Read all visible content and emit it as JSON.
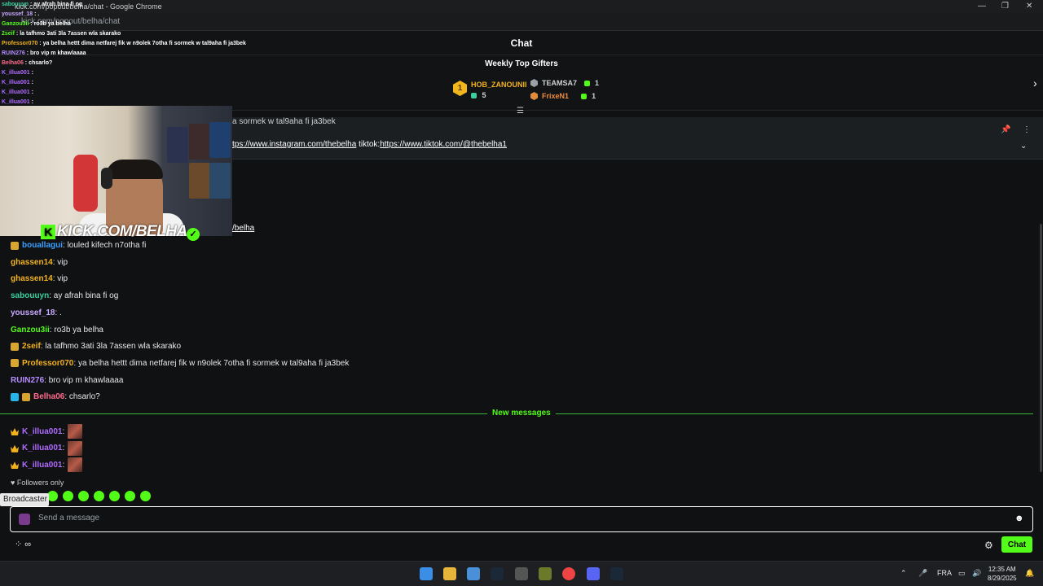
{
  "browser": {
    "window_title": "kick.com/popout/belha/chat - Google Chrome",
    "url": "kick.com/popout/belha/chat"
  },
  "header": {
    "title": "Chat"
  },
  "gifters": {
    "title": "Weekly Top Gifters",
    "first": {
      "rank": "1",
      "name": "HOB_ZANOUNII",
      "count": "5"
    },
    "second": {
      "name": "TEAMSA7",
      "count": "1"
    },
    "third": {
      "name": "FrixeN1",
      "count": "1"
    }
  },
  "pinned": {
    "top_text": "a sormek w tal9aha fi ja3bek",
    "link1": "tps://www.instagram.com/thebelha",
    "tiktok_label": " tiktok:",
    "link2": "https://www.tiktok.com/@thebelha1"
  },
  "overlay_chat": [
    {
      "user": "sabouuyn",
      "text": "ay afrah bina fi og",
      "color": "#3ad0a0"
    },
    {
      "user": "youssef_18",
      "text": ".",
      "color": "#c9a8ff"
    },
    {
      "user": "Ganzou3ii",
      "text": "ro3b ya belha",
      "color": "#53fc18"
    },
    {
      "user": "2seif",
      "text": "la tafhmo 3ati 3la 7assen wla skarako",
      "color": "#53fc18"
    },
    {
      "user": "Professor070",
      "text": "ya belha hettt dima netfarej fik w n9olek 7otha fi sormek w tal9aha fi ja3bek",
      "color": "#f2b21f"
    },
    {
      "user": "RUIN276",
      "text": "bro vip m khawlaaaa",
      "color": "#b78cff"
    },
    {
      "user": "Belha06",
      "text": "chsarlo?",
      "color": "#ff6b8a"
    },
    {
      "user": "K_illua001",
      "text": "",
      "color": "#b06bff"
    },
    {
      "user": "K_illua001",
      "text": "",
      "color": "#b06bff"
    },
    {
      "user": "K_illua001",
      "text": "",
      "color": "#b06bff"
    },
    {
      "user": "K_illua001",
      "text": "",
      "color": "#b06bff"
    }
  ],
  "webcam": {
    "logo_text": "KICK.COM/BELHA",
    "logo_k": "K"
  },
  "partial_link": "/belha",
  "messages": [
    {
      "user": "bouallagui",
      "text": "louled kifech n7otha fi",
      "color": "#3aa0ff"
    },
    {
      "user": "ghassen14",
      "text": "vip",
      "color": "#f2b21f"
    },
    {
      "user": "ghassen14",
      "text": "vip",
      "color": "#f2b21f"
    },
    {
      "user": "sabouuyn",
      "text": "ay afrah bina fi og",
      "color": "#3ad0a0"
    },
    {
      "user": "youssef_18",
      "text": ".",
      "color": "#c9a8ff"
    },
    {
      "user": "Ganzou3ii",
      "text": "ro3b ya belha",
      "color": "#53fc18"
    },
    {
      "user": "2seif",
      "text": "la tafhmo 3ati 3la 7assen wla skarako",
      "color": "#f2b21f"
    },
    {
      "user": "Professor070",
      "text": "ya belha hettt dima netfarej fik w n9olek 7otha fi sormek w tal9aha fi ja3bek",
      "color": "#f2b21f"
    },
    {
      "user": "RUIN276",
      "text": "bro vip m khawlaaaa",
      "color": "#b78cff"
    },
    {
      "user": "Belha06",
      "text": "chsarlo?",
      "color": "#ff6b8a"
    }
  ],
  "separator": ":",
  "new_messages_label": "New messages",
  "new_messages": [
    {
      "user": "K_illua001",
      "color": "#b06bff"
    },
    {
      "user": "K_illua001",
      "color": "#b06bff"
    },
    {
      "user": "K_illua001",
      "color": "#b06bff"
    }
  ],
  "followers_only": "Followers only",
  "tooltip": "Broadcaster",
  "input": {
    "placeholder": "Send a message"
  },
  "bottom": {
    "left_icons": "⁘ ∞",
    "chat_button": "Chat"
  },
  "taskbar": {
    "lang": "FRA",
    "time": "12:35 AM",
    "date": "8/29/2025"
  },
  "colors": {
    "accent": "#53fc18",
    "background": "#0f1113"
  }
}
